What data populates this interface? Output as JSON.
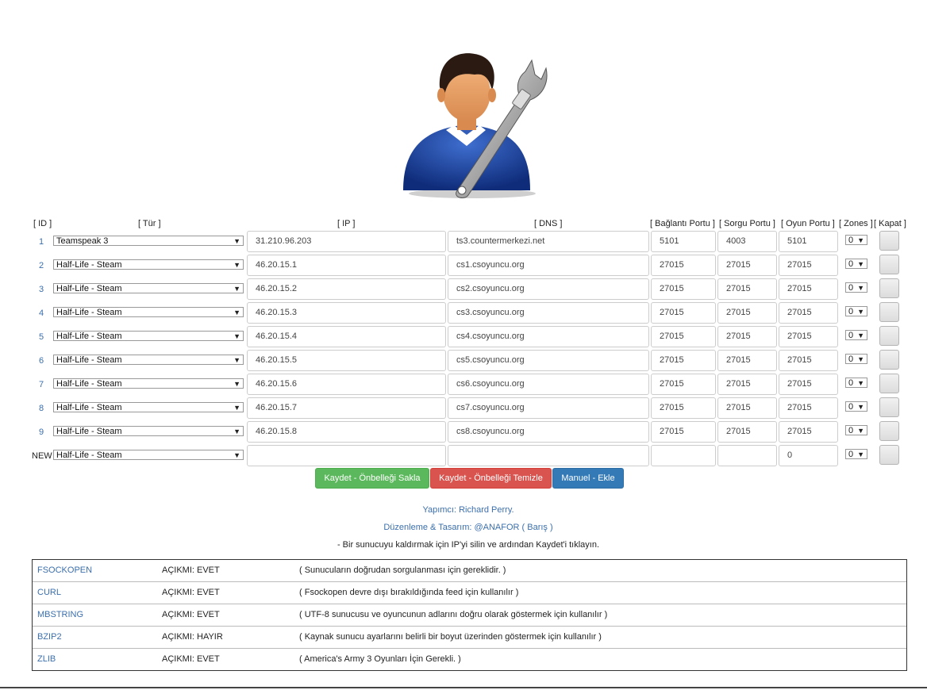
{
  "headers": {
    "id": "[ ID ]",
    "type": "[ Tür ]",
    "ip": "[ IP ]",
    "dns": "[ DNS ]",
    "conn_port": "[ Bağlantı Portu ]",
    "query_port": "[ Sorgu Portu ]",
    "game_port": "[ Oyun Portu ]",
    "zones": "[ Zones ]",
    "close": "[ Kapat ]"
  },
  "servers": [
    {
      "id": "1",
      "type": "Teamspeak 3",
      "ip": "31.210.96.203",
      "dns": "ts3.countermerkezi.net",
      "conn_port": "5101",
      "query_port": "4003",
      "game_port": "5101",
      "zone": "0"
    },
    {
      "id": "2",
      "type": "Half-Life - Steam",
      "ip": "46.20.15.1",
      "dns": "cs1.csoyuncu.org",
      "conn_port": "27015",
      "query_port": "27015",
      "game_port": "27015",
      "zone": "0"
    },
    {
      "id": "3",
      "type": "Half-Life - Steam",
      "ip": "46.20.15.2",
      "dns": "cs2.csoyuncu.org",
      "conn_port": "27015",
      "query_port": "27015",
      "game_port": "27015",
      "zone": "0"
    },
    {
      "id": "4",
      "type": "Half-Life - Steam",
      "ip": "46.20.15.3",
      "dns": "cs3.csoyuncu.org",
      "conn_port": "27015",
      "query_port": "27015",
      "game_port": "27015",
      "zone": "0"
    },
    {
      "id": "5",
      "type": "Half-Life - Steam",
      "ip": "46.20.15.4",
      "dns": "cs4.csoyuncu.org",
      "conn_port": "27015",
      "query_port": "27015",
      "game_port": "27015",
      "zone": "0"
    },
    {
      "id": "6",
      "type": "Half-Life - Steam",
      "ip": "46.20.15.5",
      "dns": "cs5.csoyuncu.org",
      "conn_port": "27015",
      "query_port": "27015",
      "game_port": "27015",
      "zone": "0"
    },
    {
      "id": "7",
      "type": "Half-Life - Steam",
      "ip": "46.20.15.6",
      "dns": "cs6.csoyuncu.org",
      "conn_port": "27015",
      "query_port": "27015",
      "game_port": "27015",
      "zone": "0"
    },
    {
      "id": "8",
      "type": "Half-Life - Steam",
      "ip": "46.20.15.7",
      "dns": "cs7.csoyuncu.org",
      "conn_port": "27015",
      "query_port": "27015",
      "game_port": "27015",
      "zone": "0"
    },
    {
      "id": "9",
      "type": "Half-Life - Steam",
      "ip": "46.20.15.8",
      "dns": "cs8.csoyuncu.org",
      "conn_port": "27015",
      "query_port": "27015",
      "game_port": "27015",
      "zone": "0"
    }
  ],
  "new_row": {
    "id_label": "NEW",
    "type": "Half-Life - Steam",
    "ip": "",
    "dns": "",
    "conn_port": "",
    "query_port": "",
    "game_port": "0",
    "zone": "0"
  },
  "buttons": {
    "save": "Kaydet - Önbelleği Sakla",
    "clear": "Kaydet - Önbelleği Temizle",
    "add": "Manuel - Ekle"
  },
  "credits": {
    "author": "Yapımcı: Richard Perry.",
    "design": "Düzenleme & Tasarım: @ANAFOR ( Barış )",
    "note": "- Bir sunucuyu kaldırmak için IP'yi silin ve ardından Kaydet'i tıklayın."
  },
  "requirements": [
    {
      "name": "FSOCKOPEN",
      "status": "AÇIKMI: EVET",
      "desc": "( Sunucuların doğrudan sorgulanması için gereklidir. )"
    },
    {
      "name": "CURL",
      "status": "AÇIKMI: EVET",
      "desc": "( Fsockopen devre dışı bırakıldığında feed için kullanılır )"
    },
    {
      "name": "MBSTRING",
      "status": "AÇIKMI: EVET",
      "desc": "( UTF-8 sunucusu ve oyuncunun adlarını doğru olarak göstermek için kullanılır )"
    },
    {
      "name": "BZIP2",
      "status": "AÇIKMI: HAYIR",
      "desc": "( Kaynak sunucu ayarlarını belirli bir boyut üzerinden göstermek için kullanılır )"
    },
    {
      "name": "ZLIB",
      "status": "AÇIKMI: EVET",
      "desc": "( America's Army 3 Oyunları İçin Gerekli. )"
    }
  ],
  "colors": {
    "save": "#5cb85c",
    "clear": "#d9534f",
    "add": "#337ab7",
    "link": "#3b6fad"
  },
  "icons": {
    "logo": "admin-user-wrench-icon",
    "dropdown": "dropdown-arrow-icon"
  }
}
